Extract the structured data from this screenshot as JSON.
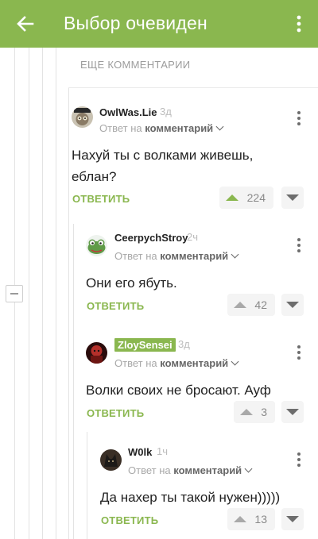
{
  "header": {
    "title": "Выбор очевиден",
    "back_icon": "arrow-left-icon",
    "menu_icon": "more-vertical-icon",
    "color": "#8ab74f"
  },
  "thread": {
    "more_comments": "ЕЩЕ КОММЕНТАРИИ"
  },
  "comments": [
    {
      "author": "OwlWas.Lie",
      "time": "3д",
      "reply_prefix": "Ответ на",
      "reply_target": "комментарий",
      "text": "Нахуй ты с волками живешь, еблан?",
      "reply_label": "ОТВЕТИТЬ",
      "score": "224",
      "upvoted": true
    },
    {
      "author": "CeerpychStroy",
      "time": "2ч",
      "reply_prefix": "Ответ на",
      "reply_target": "комментарий",
      "text": "Они его ябуть.",
      "reply_label": "ОТВЕТИТЬ",
      "score": "42"
    },
    {
      "author": "ZloySensei",
      "time": "3д",
      "reply_prefix": "Ответ на",
      "reply_target": "комментарий",
      "text": "Волки своих не бросают. Ауф",
      "reply_label": "ОТВЕТИТЬ",
      "score": "3"
    },
    {
      "author": "W0lk",
      "time": "1ч",
      "reply_prefix": "Ответ на",
      "reply_target": "комментарий",
      "text": "Да нахер ты такой нужен)))))",
      "reply_label": "ОТВЕТИТЬ",
      "score": "13"
    }
  ]
}
